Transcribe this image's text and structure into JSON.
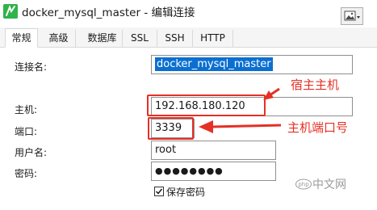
{
  "window": {
    "title": "docker_mysql_master - 编辑连接",
    "image_button_icon": "image-icon",
    "app_icon": "navicat-icon"
  },
  "tabs": [
    {
      "label": "常规",
      "active": true
    },
    {
      "label": "高级",
      "active": false
    },
    {
      "label": "数据库",
      "active": false
    },
    {
      "label": "SSL",
      "active": false
    },
    {
      "label": "SSH",
      "active": false
    },
    {
      "label": "HTTP",
      "active": false
    }
  ],
  "form": {
    "connection_name": {
      "label": "连接名:",
      "value": "docker_mysql_master"
    },
    "host": {
      "label": "主机:",
      "value": "192.168.180.120"
    },
    "port": {
      "label": "端口:",
      "value": "3339"
    },
    "username": {
      "label": "用户名:",
      "value": "root"
    },
    "password": {
      "label": "密码:",
      "value": "●●●●●●●●"
    },
    "save_password": {
      "label": "保存密码",
      "checked": true
    }
  },
  "annotations": {
    "host_note": "宿主主机",
    "port_note": "主机端口号",
    "color": "#e53025"
  },
  "watermark": {
    "text": "中文网",
    "logo_text": "php"
  },
  "colors": {
    "selection": "#0b6fd1",
    "annotation_red": "#e53025",
    "app_icon_green": "#2fb34a"
  }
}
